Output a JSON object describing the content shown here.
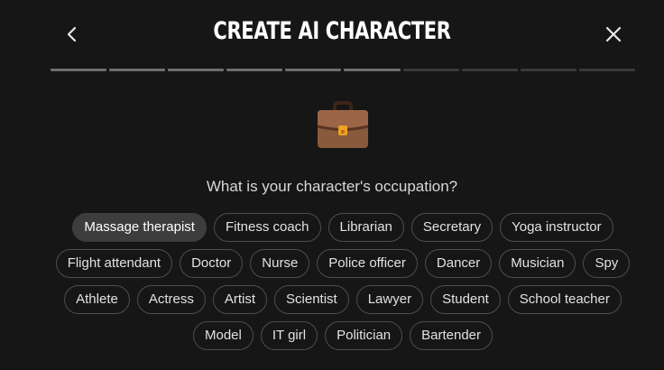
{
  "header": {
    "title": "CREATE AI CHARACTER",
    "back_icon": "chevron-left-icon",
    "close_icon": "close-icon"
  },
  "progress": {
    "total_steps": 10,
    "completed_steps": 6
  },
  "step_icon": "briefcase-icon",
  "question": "What is your character's occupation?",
  "selected": "Massage therapist",
  "occupations": [
    "Massage therapist",
    "Fitness coach",
    "Librarian",
    "Secretary",
    "Yoga instructor",
    "Flight attendant",
    "Doctor",
    "Nurse",
    "Police officer",
    "Dancer",
    "Musician",
    "Spy",
    "Athlete",
    "Actress",
    "Artist",
    "Scientist",
    "Lawyer",
    "Student",
    "School teacher",
    "Model",
    "IT girl",
    "Politician",
    "Bartender"
  ],
  "colors": {
    "background": "#161616",
    "chip_border": "#4d4d4d",
    "chip_selected_bg": "#3d3d3d",
    "progress_done": "#6e6e6e",
    "progress_todo": "#3a3a3a",
    "briefcase_brown": "#8a5a3c",
    "briefcase_clasp": "#f0a024"
  }
}
